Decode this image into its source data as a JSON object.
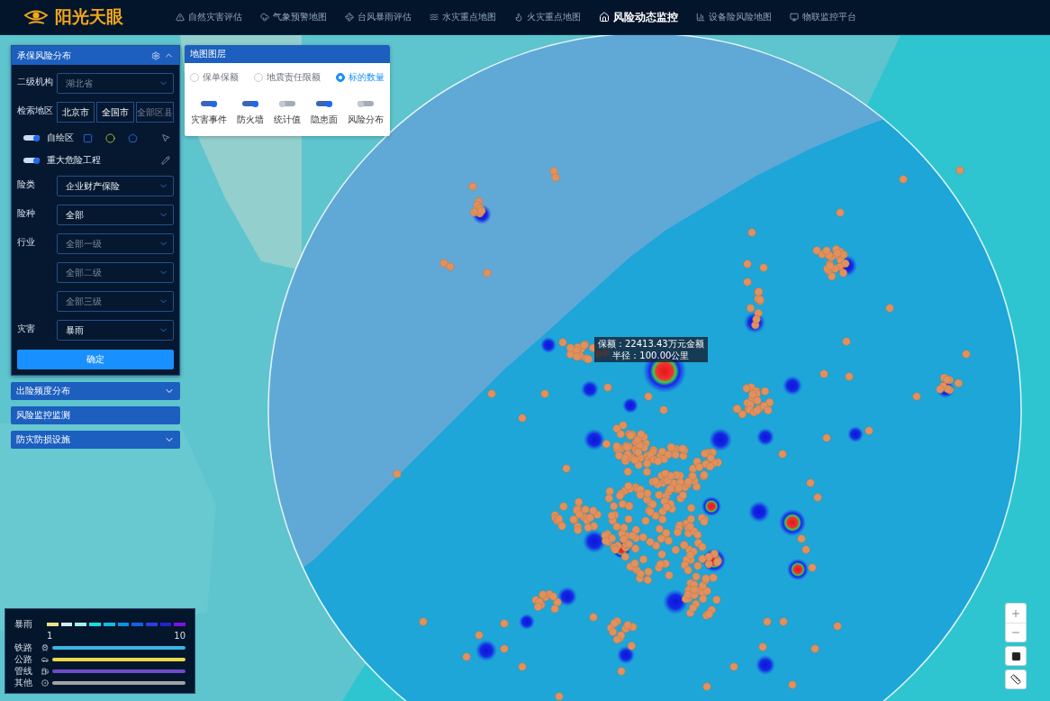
{
  "nav": {
    "logo": "阳光天眼",
    "items": [
      {
        "label": "自然灾害评估",
        "selected": false
      },
      {
        "label": "气象预警地图",
        "selected": false
      },
      {
        "label": "台风暴雨评估",
        "selected": false
      },
      {
        "label": "水灾重点地图",
        "selected": false
      },
      {
        "label": "火灾重点地图",
        "selected": false
      },
      {
        "label": "风险动态监控",
        "selected": true
      },
      {
        "label": "设备险风险地图",
        "selected": false
      },
      {
        "label": "物联监控平台",
        "selected": false
      }
    ]
  },
  "filter_panel": {
    "title": "承保风险分布",
    "expanded": true,
    "rows": [
      {
        "kind": "select",
        "label": "二级机构",
        "placeholder": "湖北省"
      },
      {
        "kind": "buttons",
        "label": "检索地区",
        "options": [
          {
            "label": "北京市",
            "disabled": false
          },
          {
            "label": "全国市",
            "disabled": false
          },
          {
            "label": "全部区县",
            "disabled": true
          }
        ]
      },
      {
        "kind": "draw-toggle",
        "label": "自绘区",
        "on": true
      },
      {
        "kind": "pen-toggle",
        "label": "重大危险工程",
        "on": true
      },
      {
        "kind": "select",
        "label": "险类",
        "value": "企业财产保险"
      },
      {
        "kind": "select",
        "label": "险种",
        "value": "全部"
      },
      {
        "kind": "select",
        "label": "行业",
        "placeholder": "全部一级"
      },
      {
        "kind": "select",
        "placeholder": "全部二级"
      },
      {
        "kind": "select",
        "placeholder": "全部三级"
      },
      {
        "kind": "select",
        "label": "灾害",
        "value": "暴雨"
      }
    ],
    "submit": "确定"
  },
  "accordions": [
    {
      "title": "出险频度分布",
      "expandable": true
    },
    {
      "title": "风险监控监测",
      "expandable": false
    },
    {
      "title": "防灾防损设施",
      "expandable": true
    }
  ],
  "layer_panel": {
    "title": "地图图层",
    "radios": [
      {
        "label": "保单保额",
        "selected": false
      },
      {
        "label": "地震责任限额",
        "selected": false
      },
      {
        "label": "标的数量",
        "selected": true
      }
    ],
    "toggles": [
      {
        "label": "灾害事件",
        "on": true
      },
      {
        "label": "防火墙",
        "on": true
      },
      {
        "label": "统计值",
        "on": false
      },
      {
        "label": "隐患面",
        "on": true
      },
      {
        "label": "风险分布",
        "on": false
      }
    ]
  },
  "map_tooltip": [
    "保额：22413.43万元金额",
    "半径：100.00公里"
  ],
  "legend": {
    "scale": {
      "label": "暴雨",
      "segments": [
        {
          "color": "#eee08a"
        },
        {
          "color": "#c9f1ef"
        },
        {
          "color": "#a3efee"
        },
        {
          "color": "#12e0e0"
        },
        {
          "color": "#0cc0e2"
        },
        {
          "color": "#0a92e6"
        },
        {
          "color": "#1262e4"
        },
        {
          "color": "#2a3fe0"
        },
        {
          "color": "#2224d2"
        },
        {
          "color": "#7a14e4"
        }
      ],
      "min": "1",
      "max": "10"
    },
    "lines": [
      {
        "label": "铁路",
        "color": "#3ab6e2"
      },
      {
        "label": "公路",
        "color": "#e9d84c"
      },
      {
        "label": "管线",
        "color": "#6f4bc4"
      },
      {
        "label": "其他",
        "color": "#a3a3a3"
      }
    ]
  }
}
